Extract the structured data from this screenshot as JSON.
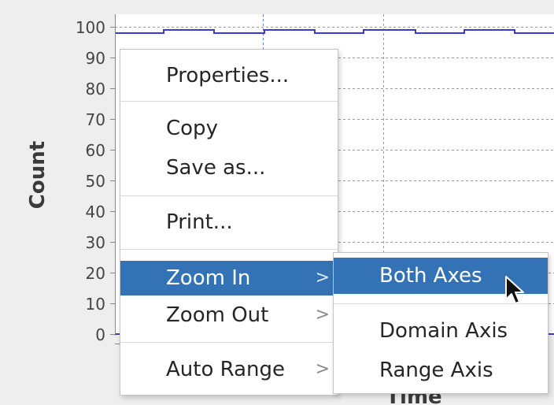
{
  "chart": {
    "ylabel": "Count",
    "xlabel": "Time",
    "y_ticks": [
      "100",
      "90",
      "80",
      "70",
      "60",
      "50",
      "40",
      "30",
      "20",
      "10",
      "0"
    ],
    "series_color": "#3a3acc",
    "grid_color": "#888888",
    "background_color": "#ffffff"
  },
  "context_menu": {
    "items": [
      {
        "label": "Properties...",
        "has_submenu": false
      },
      {
        "label": "Copy",
        "has_submenu": false
      },
      {
        "label": "Save as...",
        "has_submenu": false
      },
      {
        "label": "Print...",
        "has_submenu": false
      },
      {
        "label": "Zoom In",
        "has_submenu": true,
        "highlighted": true
      },
      {
        "label": "Zoom Out",
        "has_submenu": true
      },
      {
        "label": "Auto Range",
        "has_submenu": true
      }
    ],
    "submenu_arrow": ">"
  },
  "zoom_submenu": {
    "items": [
      {
        "label": "Both Axes",
        "highlighted": true
      },
      {
        "label": "Domain Axis"
      },
      {
        "label": "Range Axis"
      }
    ]
  },
  "colors": {
    "highlight": "#3272b5",
    "menu_background": "#ffffff",
    "window_background": "#eeeeee"
  },
  "cursor": "arrow-pointer-icon"
}
